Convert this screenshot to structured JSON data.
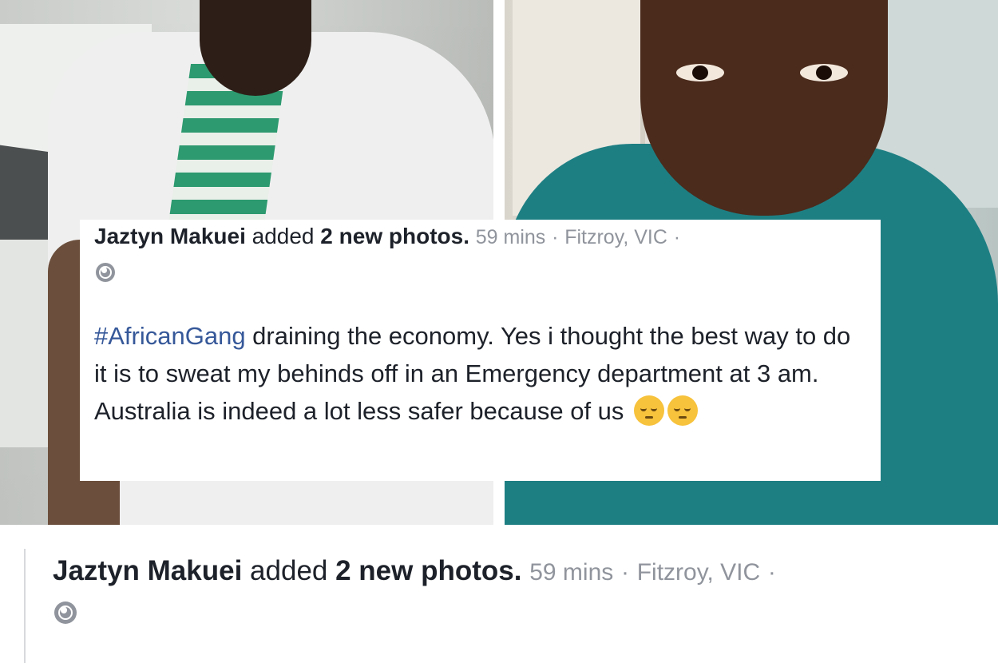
{
  "post": {
    "author": "Jaztyn Makuei",
    "action_text": "added",
    "action_bold": "2 new photos.",
    "time": "59 mins",
    "separator": "·",
    "location": "Fitzroy, VIC",
    "trailing_separator": "·",
    "privacy_icon": "globe-icon",
    "hashtag": "#AfricanGang",
    "body_text": " draining the economy. Yes i thought the best way to do it is to sweat my behinds off in an Emergency department at 3 am. Australia is indeed a lot less safer because of us",
    "emojis": [
      "pensive-face",
      "pensive-face"
    ]
  },
  "colors": {
    "text": "#1d2129",
    "meta": "#90949c",
    "hashtag": "#365899"
  }
}
